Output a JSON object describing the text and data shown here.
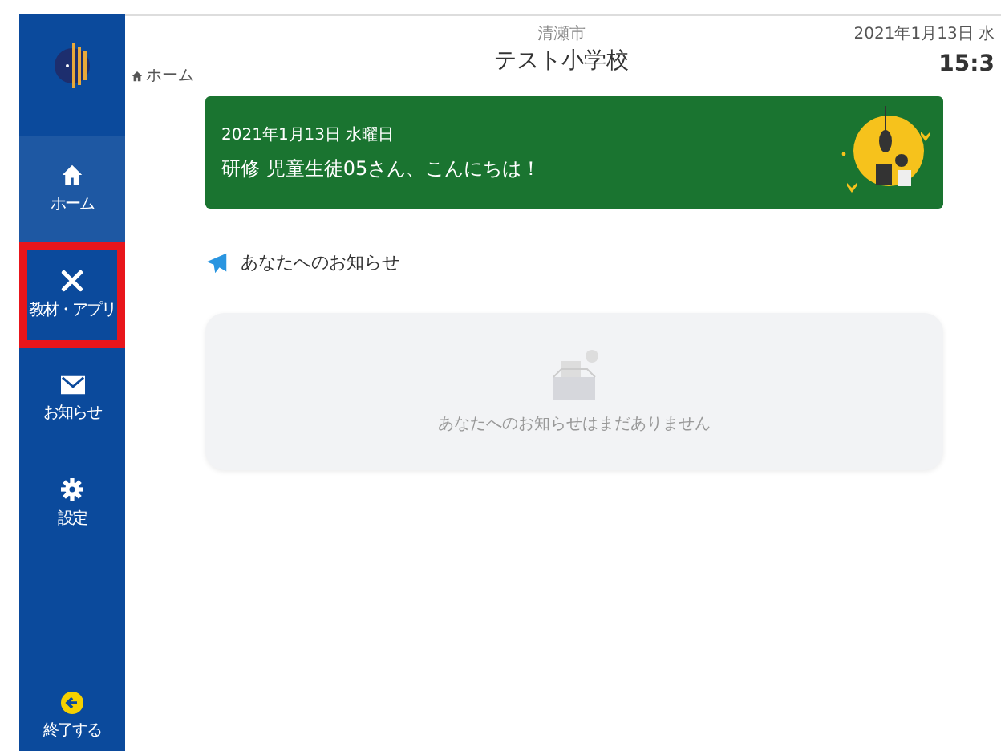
{
  "sidebar": {
    "items": [
      {
        "kind": "home",
        "label": "ホーム",
        "selected": true,
        "highlighted": false
      },
      {
        "kind": "apps",
        "label": "教材・アプリ",
        "selected": false,
        "highlighted": true
      },
      {
        "kind": "notice",
        "label": "お知らせ",
        "selected": false,
        "highlighted": false
      },
      {
        "kind": "settings",
        "label": "設定",
        "selected": false,
        "highlighted": false
      }
    ],
    "exit": {
      "label": "終了する"
    }
  },
  "header": {
    "city": "清瀬市",
    "school": "テスト小学校",
    "date": "2021年1月13日 水",
    "time": "15:3"
  },
  "breadcrumb": "ホーム",
  "banner": {
    "date": "2021年1月13日 水曜日",
    "greeting": "研修 児童生徒05さん、こんにちは！"
  },
  "notices": {
    "title": "あなたへのお知らせ",
    "empty_message": "あなたへのお知らせはまだありません"
  }
}
